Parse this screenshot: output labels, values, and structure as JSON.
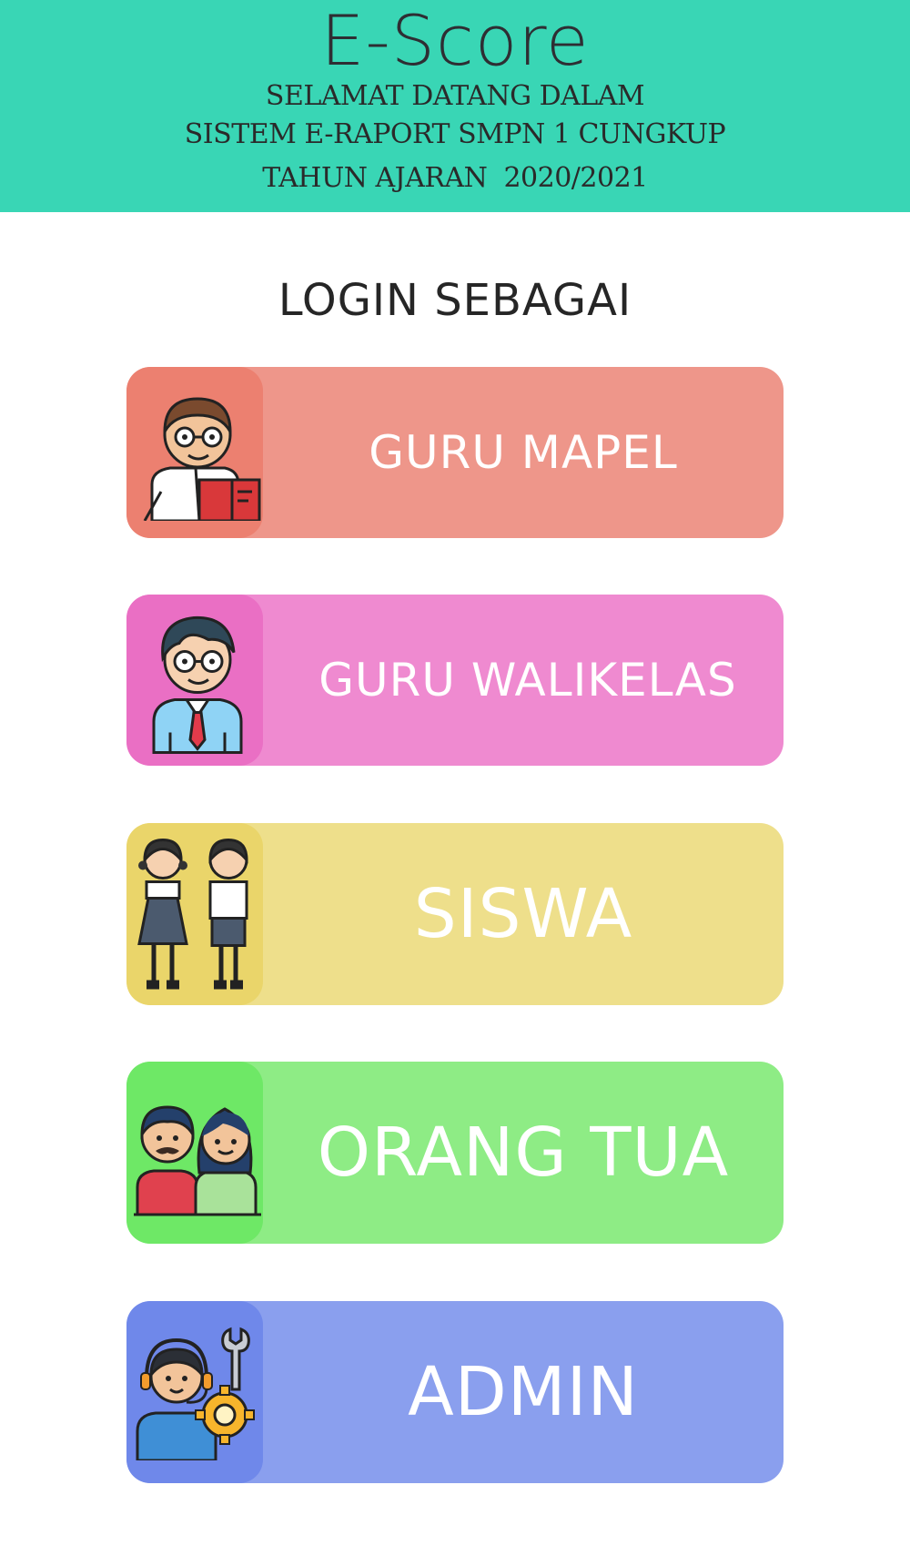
{
  "header": {
    "title": "E-Score",
    "line1": "SELAMAT DATANG DALAM",
    "line2": "SISTEM E-RAPORT SMPN 1 CUNGKUP",
    "line3": "TAHUN AJARAN  2020/2021",
    "background": "#39d6b5"
  },
  "login": {
    "heading": "LOGIN SEBAGAI",
    "roles": [
      {
        "label": "GURU MAPEL",
        "icon": "teacher-desk-icon",
        "color": "#ee968a"
      },
      {
        "label": "GURU WALIKELAS",
        "icon": "homeroom-teacher-icon",
        "color": "#ef8ad0"
      },
      {
        "label": "SISWA",
        "icon": "students-icon",
        "color": "#eedf8b"
      },
      {
        "label": "ORANG TUA",
        "icon": "parents-icon",
        "color": "#8eec85"
      },
      {
        "label": "ADMIN",
        "icon": "admin-support-icon",
        "color": "#8a9fee"
      }
    ]
  }
}
